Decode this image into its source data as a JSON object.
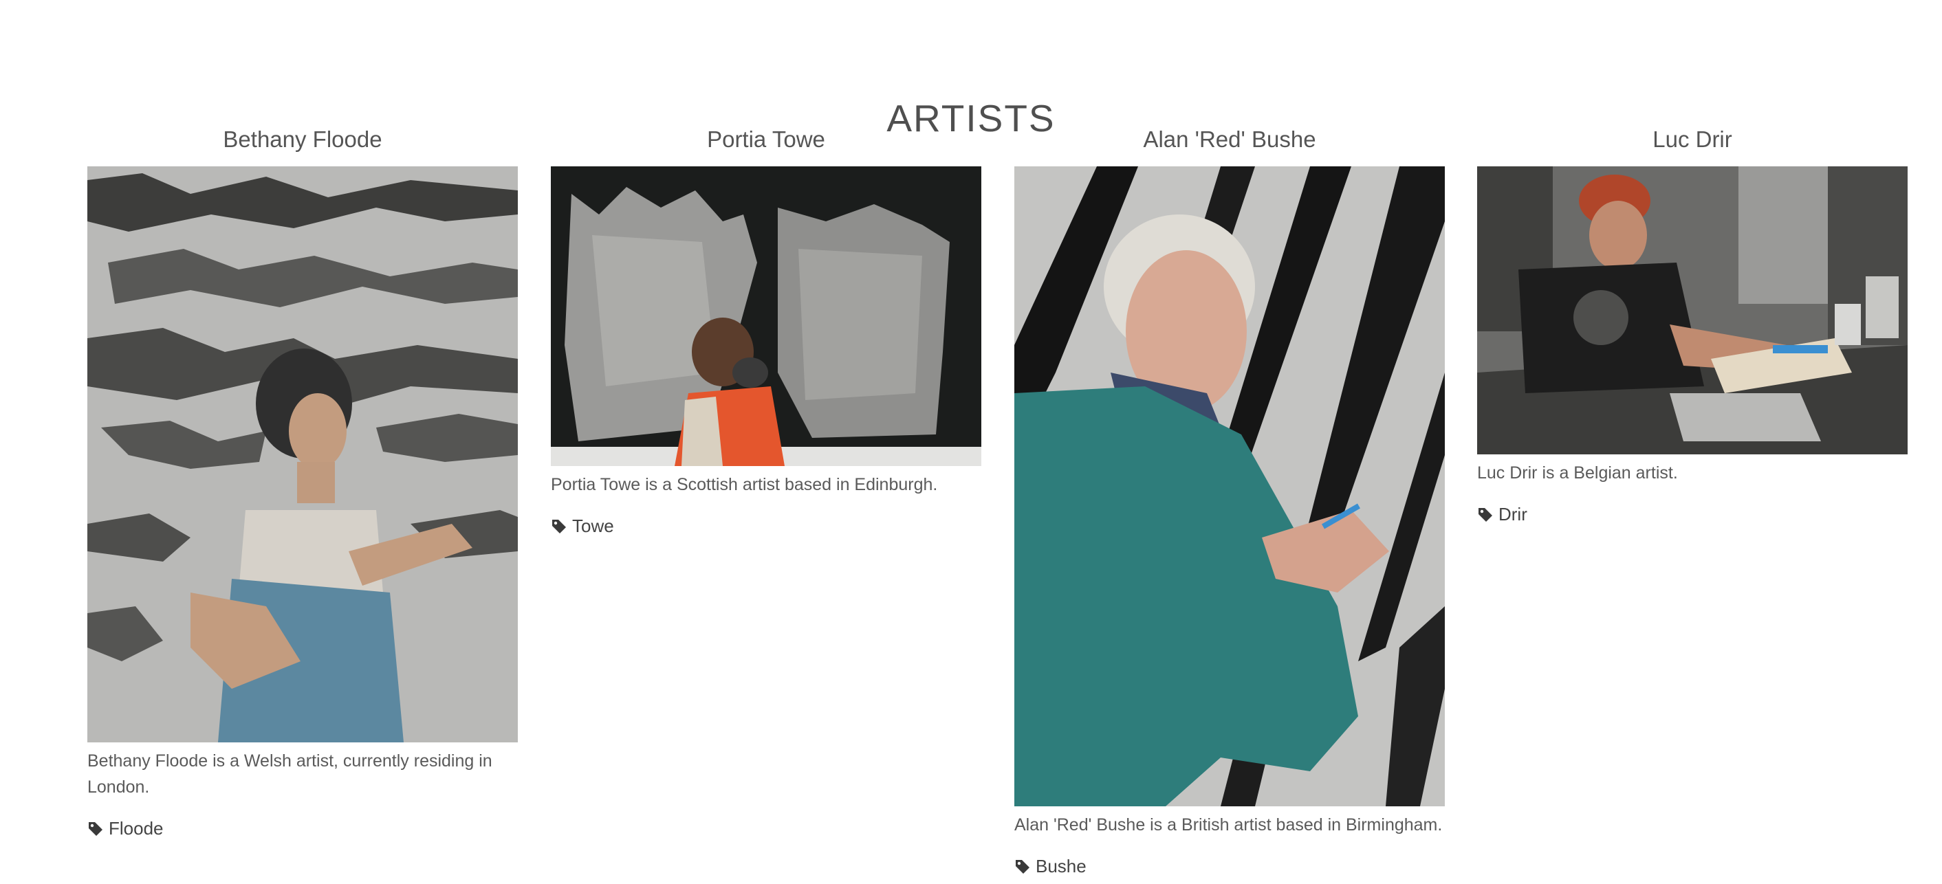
{
  "page": {
    "title": "ARTISTS"
  },
  "artists": [
    {
      "name": "Bethany Floode",
      "bio": "Bethany Floode is a Welsh artist, currently residing in London.",
      "tag": "Floode",
      "tag_icon": "tag-icon",
      "photo": "photo of artist painting in front of cracked-paint wall"
    },
    {
      "name": "Portia Towe",
      "bio": "Portia Towe is a Scottish artist based in Edinburgh.",
      "tag": "Towe",
      "tag_icon": "tag-icon",
      "photo": "photo of artist in front of dark canvas with white paint"
    },
    {
      "name": "Alan 'Red' Bushe",
      "bio": "Alan 'Red' Bushe is a British artist based in Birmingham.",
      "tag": "Bushe",
      "tag_icon": "tag-icon",
      "photo": "photo of artist drawing on large black-and-white canvas"
    },
    {
      "name": "Luc Drir",
      "bio": "Luc Drir is a Belgian artist.",
      "tag": "Drir",
      "tag_icon": "tag-icon",
      "photo": "photo of artist drawing at a workbench with a laptop"
    }
  ],
  "colors": {
    "text": "#4a4a4a",
    "background": "#ffffff"
  }
}
